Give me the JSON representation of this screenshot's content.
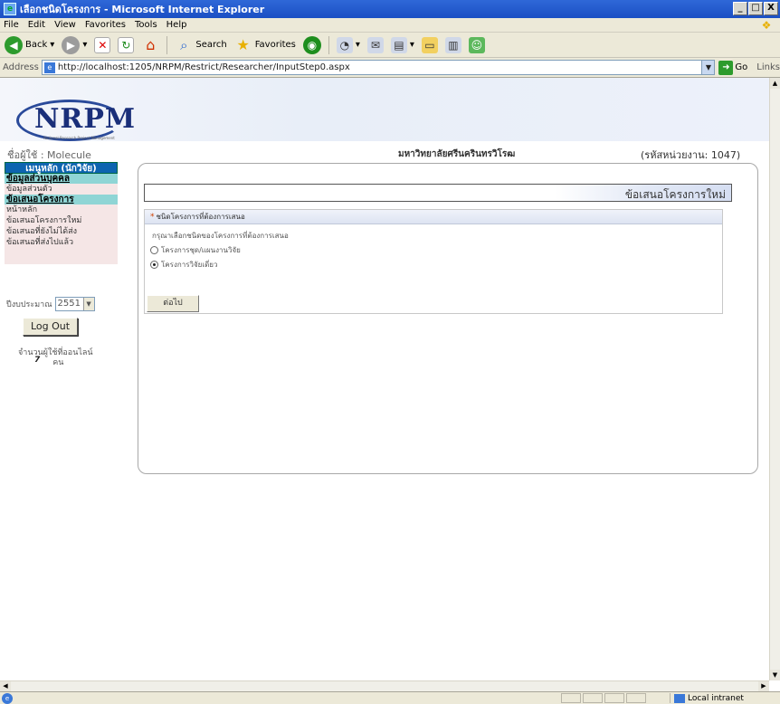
{
  "window": {
    "title": "เลือกชนิดโครงการ - Microsoft Internet Explorer",
    "minimize": "_",
    "maximize": "□",
    "close": "X"
  },
  "menubar": [
    "File",
    "Edit",
    "View",
    "Favorites",
    "Tools",
    "Help"
  ],
  "toolbar": {
    "back_label": "Back",
    "search_label": "Search",
    "favorites_label": "Favorites"
  },
  "address": {
    "label": "Address",
    "url": "http://localhost:1205/NRPM/Restrict/Researcher/InputStep0.aspx",
    "go_label": "Go",
    "links_label": "Links"
  },
  "header": {
    "logo_text": "NRPM",
    "logo_subtitle": "National Research Project Management"
  },
  "user_line": "ชื่อผู้ใช้ : Molecule",
  "university": "มหาวิทยาลัยศรีนครินทรวิโรฒ",
  "unit_code": "(รหัสหน่วยงาน: 1047)",
  "sidebar": {
    "heading": "เมนูหลัก (นักวิจัย)",
    "sections": [
      {
        "title": "ข้อมูลส่วนบุคคล",
        "items": [
          "ข้อมูลส่วนตัว"
        ]
      },
      {
        "title": "ข้อเสนอโครงการ",
        "items": [
          "หน้าหลัก",
          "ข้อเสนอโครงการใหม่",
          "ข้อเสนอที่ยังไม่ได้ส่ง",
          "ข้อเสนอที่ส่งไปแล้ว"
        ]
      }
    ]
  },
  "budget": {
    "label": "ปีงบประมาณ",
    "value": "2551"
  },
  "logout_label": "Log Out",
  "online": {
    "label": "จำนวนผู้ใช้ที่ออนไลน์",
    "count": "7",
    "unit": "คน"
  },
  "main": {
    "title": "ข้อเสนอโครงการใหม่",
    "form_header": "ชนิดโครงการที่ต้องการเสนอ",
    "instruction": "กรุณาเลือกชนิดของโครงการที่ต้องการเสนอ",
    "options": [
      {
        "label": "โครงการชุด/แผนงานวิจัย",
        "selected": false
      },
      {
        "label": "โครงการวิจัยเดี่ยว",
        "selected": true
      }
    ],
    "next_label": "ต่อไป"
  },
  "statusbar": {
    "zone": "Local intranet"
  }
}
